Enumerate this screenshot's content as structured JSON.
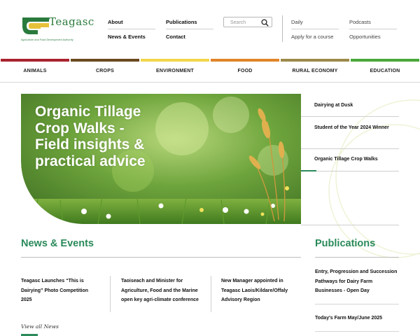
{
  "logo": {
    "wordmark": "Teagasc",
    "tagline": "Agriculture and Food Development Authority"
  },
  "topnav": {
    "about": "About",
    "publications": "Publications",
    "news_events": "News & Events",
    "contact": "Contact"
  },
  "search": {
    "placeholder": "Search"
  },
  "utilnav": {
    "daily": "Daily",
    "podcasts": "Podcasts",
    "apply": "Apply for a course",
    "opportunities": "Opportunities"
  },
  "categories": [
    {
      "label": "ANIMALS",
      "color": "#a8232e"
    },
    {
      "label": "CROPS",
      "color": "#6b4a1e"
    },
    {
      "label": "ENVIRONMENT",
      "color": "#f2d64b"
    },
    {
      "label": "FOOD",
      "color": "#e0852a"
    },
    {
      "label": "RURAL ECONOMY",
      "color": "#9d8a4a"
    },
    {
      "label": "EDUCATION",
      "color": "#4aa83a"
    }
  ],
  "hero": {
    "headline": "Organic Tillage Crop Walks - Field insights & practical advice"
  },
  "sidelist": [
    {
      "label": "Dairying at Dusk"
    },
    {
      "label": "Student of the Year 2024 Winner"
    },
    {
      "label": "Organic Tillage Crop Walks",
      "active": true
    }
  ],
  "news": {
    "title": "News & Events",
    "items": [
      "Teagasc Launches “This is Dairying” Photo Competition 2025",
      "Taoiseach and Minister for Agriculture, Food and the Marine open key agri-climate conference",
      "New Manager appointed in Teagasc Laois/Kildare/Offaly Advisory Region"
    ],
    "view_all": "View all News"
  },
  "publications": {
    "title": "Publications",
    "items": [
      "Entry, Progression and Succession Pathways for Dairy Farm Businesses - Open Day",
      "Today's Farm May/June 2025"
    ]
  },
  "colors": {
    "brand_green": "#2a8a5a",
    "text": "#111111"
  }
}
